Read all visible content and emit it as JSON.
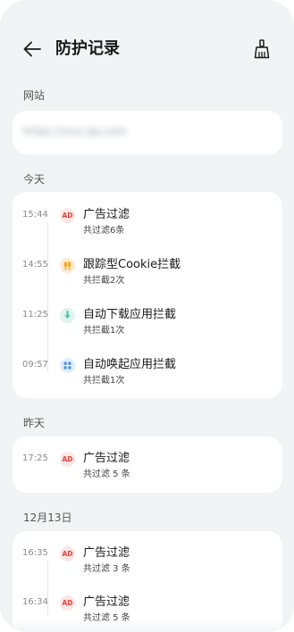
{
  "header": {
    "title": "防护记录"
  },
  "website_section": {
    "label": "网站",
    "url": "https://xxx.qq.com"
  },
  "groups": [
    {
      "label": "今天",
      "entries": [
        {
          "time": "15:44",
          "icon": "ad-icon",
          "badge_text": "AD",
          "title": "广告过滤",
          "sub": "共过滤6条"
        },
        {
          "time": "14:55",
          "icon": "footprints-icon",
          "title": "跟踪型Cookie拦截",
          "sub": "共拦截2次"
        },
        {
          "time": "11:25",
          "icon": "download-icon",
          "title": "自动下载应用拦截",
          "sub": "共拦截1次"
        },
        {
          "time": "09:57",
          "icon": "apps-icon",
          "title": "自动唤起应用拦截",
          "sub": "共拦截1次"
        }
      ]
    },
    {
      "label": "昨天",
      "entries": [
        {
          "time": "17:25",
          "icon": "ad-icon",
          "badge_text": "AD",
          "title": "广告过滤",
          "sub": "共过滤 5 条"
        }
      ]
    },
    {
      "label": "12月13日",
      "entries": [
        {
          "time": "16:35",
          "icon": "ad-icon",
          "badge_text": "AD",
          "title": "广告过滤",
          "sub": "共过滤 3 条"
        },
        {
          "time": "16:34",
          "icon": "ad-icon",
          "badge_text": "AD",
          "title": "广告过滤",
          "sub": "共过滤 5 条"
        }
      ]
    }
  ],
  "colors": {
    "background": "#f1f3f5",
    "card": "#ffffff",
    "ad_red": "#e4453a",
    "cookie_orange": "#f5a623",
    "download_teal": "#3cc6a8",
    "app_blue": "#4a90e2"
  }
}
